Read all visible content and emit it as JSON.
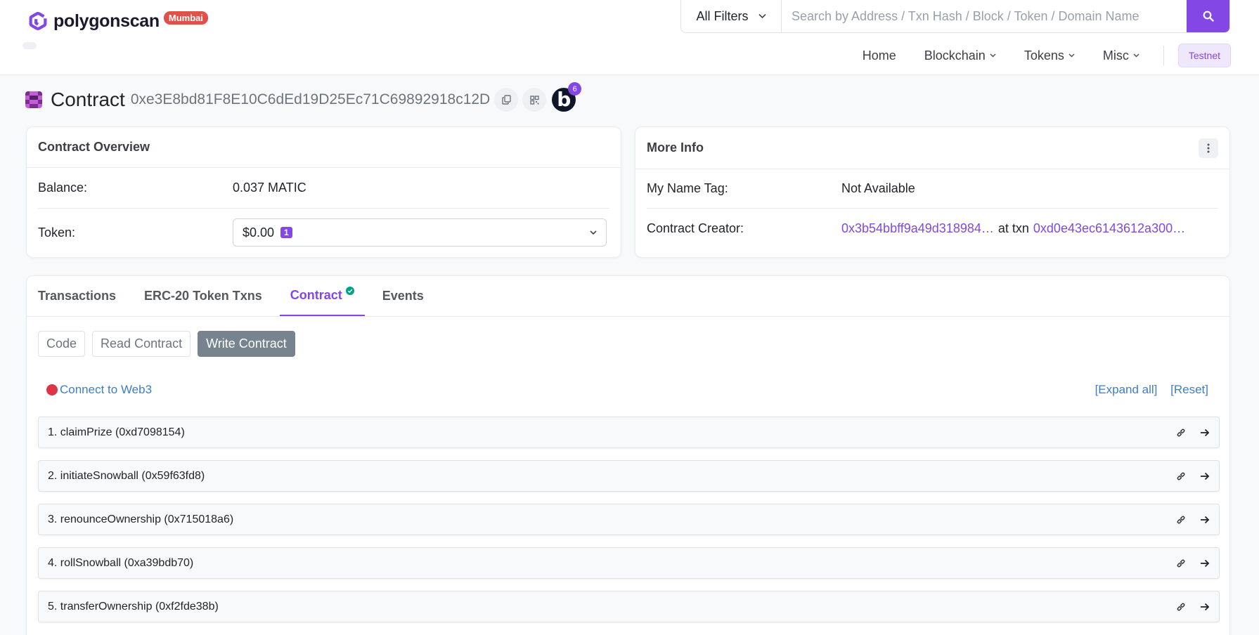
{
  "brand": {
    "name": "polygonscan",
    "network": "Mumbai",
    "accent": "#8247e5"
  },
  "search": {
    "filter": "All Filters",
    "placeholder": "Search by Address / Txn Hash / Block / Token / Domain Name"
  },
  "nav": {
    "items": [
      {
        "label": "Home"
      },
      {
        "label": "Blockchain"
      },
      {
        "label": "Tokens"
      },
      {
        "label": "Misc"
      }
    ],
    "testnet": "Testnet"
  },
  "page": {
    "title": "Contract",
    "address": "0xe3E8bd81F8E10C6dEd19D25Ec71C69892918c12D",
    "b_count": "6",
    "b_letter": "b"
  },
  "overview": {
    "title": "Contract Overview",
    "balance_label": "Balance:",
    "balance_value": "0.037 MATIC",
    "token_label": "Token:",
    "token_value": "$0.00",
    "token_count": "1"
  },
  "more_info": {
    "title": "More Info",
    "name_tag_label": "My Name Tag:",
    "name_tag_value": "Not Available",
    "creator_label": "Contract Creator:",
    "creator_address": "0x3b54bbff9a49d318984…",
    "at_txn": "at txn",
    "creator_txn": "0xd0e43ec6143612a300…"
  },
  "tabs": [
    {
      "label": "Transactions"
    },
    {
      "label": "ERC-20 Token Txns"
    },
    {
      "label": "Contract"
    },
    {
      "label": "Events"
    }
  ],
  "subtabs": [
    {
      "label": "Code"
    },
    {
      "label": "Read Contract"
    },
    {
      "label": "Write Contract"
    }
  ],
  "web3": {
    "connect": "Connect to Web3",
    "expand_all": "[Expand all]",
    "reset": "[Reset]"
  },
  "functions": [
    {
      "label": "1. claimPrize (0xd7098154)"
    },
    {
      "label": "2. initiateSnowball (0x59f63fd8)"
    },
    {
      "label": "3. renounceOwnership (0x715018a6)"
    },
    {
      "label": "4. rollSnowball (0xa39bdb70)"
    },
    {
      "label": "5. transferOwnership (0xf2fde38b)"
    }
  ]
}
